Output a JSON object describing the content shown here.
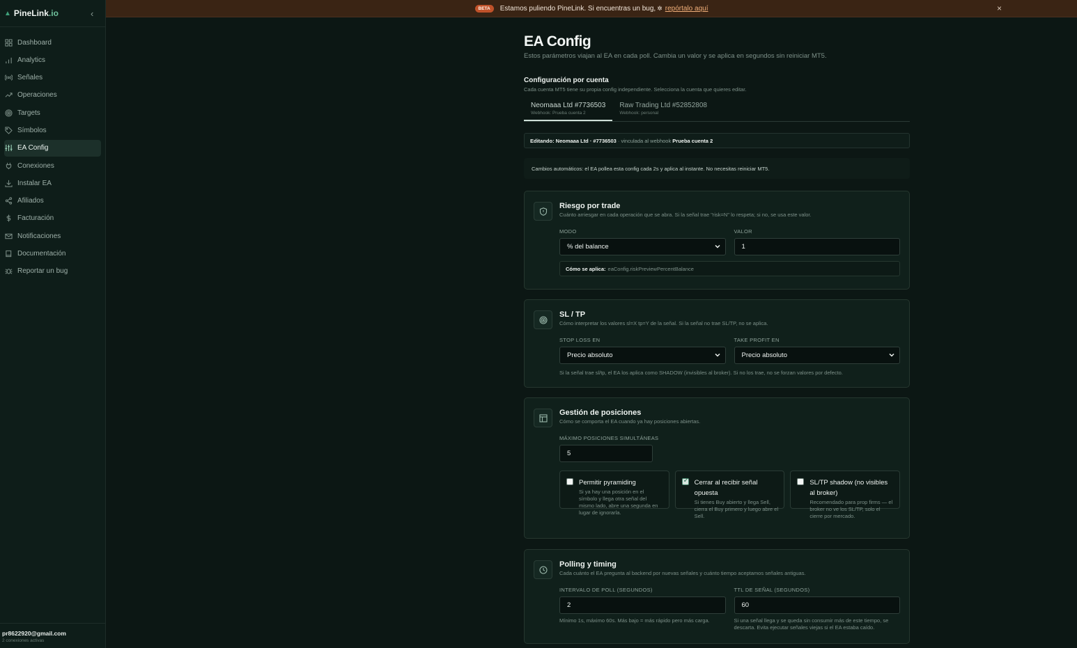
{
  "brand": {
    "name": "PineLink",
    "suffix": ".io",
    "collapse": "‹"
  },
  "sidebar": {
    "items": [
      {
        "label": "Dashboard",
        "icon": "grid-icon"
      },
      {
        "label": "Analytics",
        "icon": "bar-chart-icon"
      },
      {
        "label": "Señales",
        "icon": "signal-icon"
      },
      {
        "label": "Operaciones",
        "icon": "trend-icon"
      },
      {
        "label": "Targets",
        "icon": "target-icon"
      },
      {
        "label": "Símbolos",
        "icon": "tag-icon"
      },
      {
        "label": "EA Config",
        "icon": "sliders-icon",
        "active": true
      },
      {
        "label": "Conexiones",
        "icon": "plug-icon"
      },
      {
        "label": "Instalar EA",
        "icon": "download-icon"
      },
      {
        "label": "Afiliados",
        "icon": "share-icon"
      },
      {
        "label": "Facturación",
        "icon": "dollar-icon"
      },
      {
        "label": "Notificaciones",
        "icon": "mail-icon"
      },
      {
        "label": "Documentación",
        "icon": "book-icon"
      },
      {
        "label": "Reportar un bug",
        "icon": "bug-icon"
      }
    ]
  },
  "user": {
    "email": "pr8622920@gmail.com",
    "sub": "2 conexiones activas"
  },
  "banner": {
    "badge": "BETA",
    "text": "Estamos puliendo PineLink. Si encuentras un bug,",
    "link": "repórtalo aquí",
    "close": "×"
  },
  "page": {
    "title": "EA Config",
    "lead": "Estos parámetros viajan al EA en cada poll. Cambia un valor y se aplica en segundos sin reiniciar MT5.",
    "section_title": "Configuración por cuenta",
    "section_sub": "Cada cuenta MT5 tiene su propia config independiente. Selecciona la cuenta que quieres editar.",
    "tabs": [
      {
        "label": "Neomaaa Ltd #7736503",
        "sub": "Webhook: Prueba cuenta 2"
      },
      {
        "label": "Raw Trading Ltd #52852808",
        "sub": "Webhook: personal"
      }
    ],
    "editing": {
      "prefix": "Editando:",
      "account": "Neomaaa Ltd · #7736503",
      "middle": "· vinculada al webhook",
      "webhook": "Prueba cuenta 2"
    },
    "auto_notice": "Cambios automáticos: el EA pollea esta config cada 2s y aplica al instante. No necesitas reiniciar MT5."
  },
  "risk": {
    "title": "Riesgo por trade",
    "sub": "Cuánto arriesgar en cada operación que se abra. Si la señal trae \"risk=N\" lo respeta; si no, se usa este valor.",
    "mode_label": "MODO",
    "mode_value": "% del balance",
    "value_label": "VALOR",
    "value": "1",
    "how_label": "Cómo se aplica:",
    "how_value": "eaConfig.riskPreviewPercentBalance"
  },
  "sltp": {
    "title": "SL / TP",
    "sub": "Cómo interpretar los valores sl=X tp=Y de la señal. Si la señal no trae SL/TP, no se aplica.",
    "sl_label": "STOP LOSS EN",
    "sl_value": "Precio absoluto",
    "tp_label": "TAKE PROFIT EN",
    "tp_value": "Precio absoluto",
    "hint": "Si la señal trae sl/tp, el EA los aplica como SHADOW (invisibles al broker). Si no los trae, no se forzan valores por defecto."
  },
  "positions": {
    "title": "Gestión de posiciones",
    "sub": "Cómo se comporta el EA cuando ya hay posiciones abiertas.",
    "max_label": "MÁXIMO POSICIONES SIMULTÁNEAS",
    "max_value": "5",
    "checks": [
      {
        "title": "Permitir pyramiding",
        "desc": "Si ya hay una posición en el símbolo y llega otra señal del mismo lado, abre una segunda en lugar de ignorarla.",
        "checked": false
      },
      {
        "title": "Cerrar al recibir señal opuesta",
        "desc": "Si tienes Buy abierto y llega Sell, cierra el Buy primero y luego abre el Sell.",
        "checked": true
      },
      {
        "title": "SL/TP shadow (no visibles al broker)",
        "desc": "Recomendado para prop firms — el broker no ve los SL/TP, solo el cierre por mercado.",
        "checked": false
      }
    ]
  },
  "polling": {
    "title": "Polling y timing",
    "sub": "Cada cuánto el EA pregunta al backend por nuevas señales y cuánto tiempo aceptamos señales antiguas.",
    "poll_label": "INTERVALO DE POLL (SEGUNDOS)",
    "poll_value": "2",
    "poll_hint": "Mínimo 1s, máximo 60s. Más bajo = más rápido pero más carga.",
    "ttl_label": "TTL DE SEÑAL (SEGUNDOS)",
    "ttl_value": "60",
    "ttl_hint": "Si una señal llega y se queda sin consumir más de este tiempo, se descarta. Evita ejecutar señales viejas si el EA estaba caído."
  }
}
